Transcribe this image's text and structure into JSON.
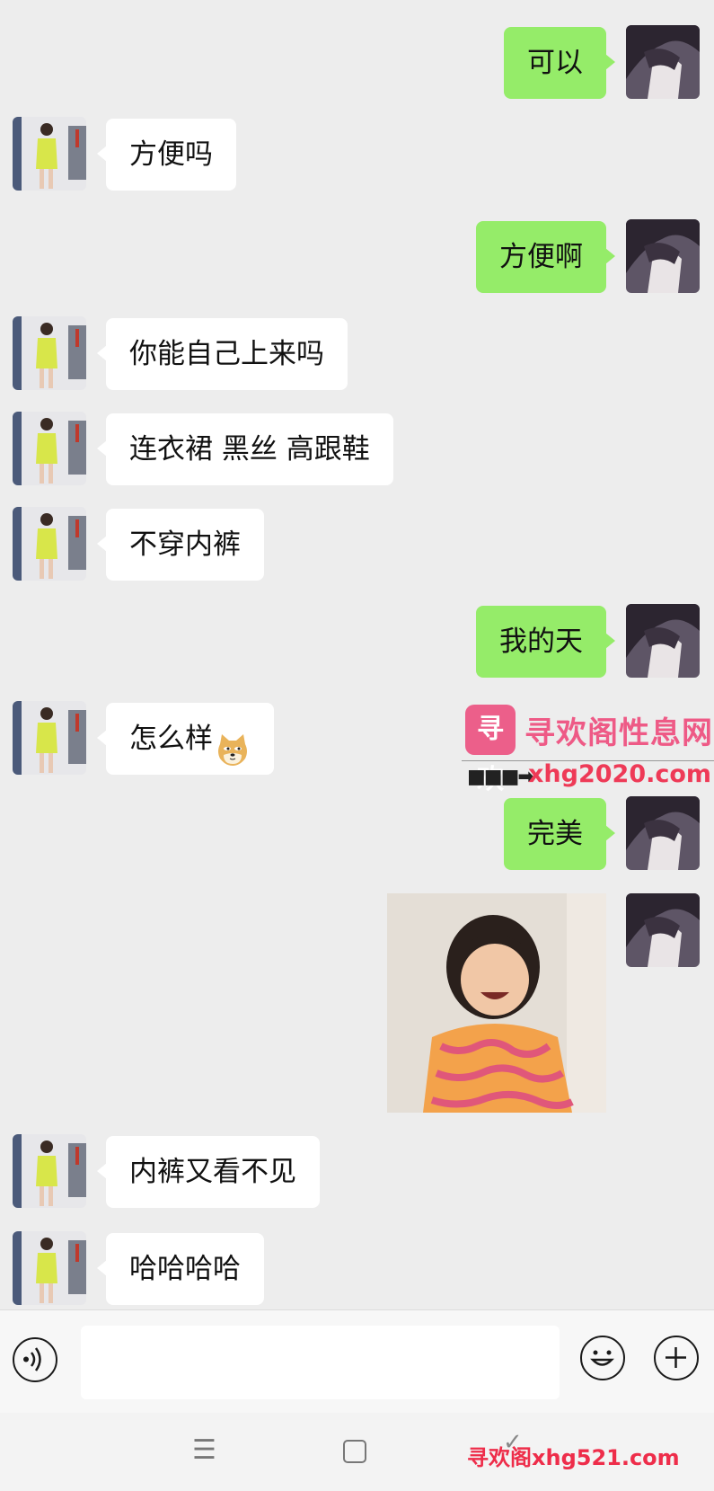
{
  "messages": [
    {
      "side": "right",
      "text": "可以"
    },
    {
      "side": "left",
      "text": "方便吗"
    },
    {
      "side": "right",
      "text": "方便啊"
    },
    {
      "side": "left",
      "text": "你能自己上来吗"
    },
    {
      "side": "left",
      "text": "连衣裙 黑丝 高跟鞋"
    },
    {
      "side": "left",
      "text": "不穿内裤"
    },
    {
      "side": "right",
      "text": "我的天"
    },
    {
      "side": "left",
      "text": "怎么样",
      "emoji": "doge-emoji-icon"
    },
    {
      "side": "right",
      "text": "完美"
    },
    {
      "side": "right",
      "image": "laughing-child-photo"
    },
    {
      "side": "left",
      "text": "内裤又看不见"
    },
    {
      "side": "left",
      "text": "哈哈哈哈"
    }
  ],
  "watermark": {
    "logo_text": "寻欢",
    "brand": "寻欢阁性息网",
    "url": "xhg2020.com",
    "arrow": "■■■➡"
  },
  "input_bar": {
    "voice_icon": "voice-icon",
    "emoji_icon": "smiley-icon",
    "plus_icon": "plus-icon",
    "placeholder": ""
  },
  "nav_bar": {
    "menu_glyph": "☰",
    "back_glyph": "✓",
    "watermark_text": "寻欢阁xhg521.com"
  },
  "colors": {
    "background": "#ededed",
    "bubble_sent": "#95ec69",
    "bubble_received": "#ffffff",
    "watermark_pink": "#ee5a86"
  }
}
